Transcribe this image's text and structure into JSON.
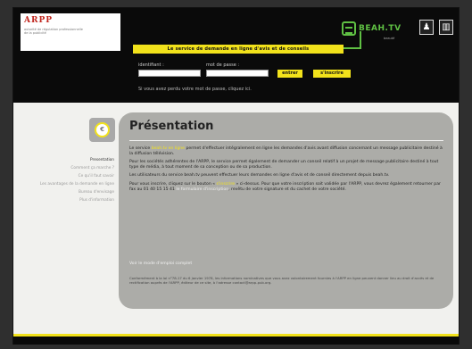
{
  "header": {
    "logo_title": "ARPP",
    "logo_subtitle": "autorité de régulation professionnelle de la publicité",
    "brand_name": "BEAH.TV",
    "brand_sub": "beauté",
    "tagline": "Le service de demande en ligne d'avis et de conseils",
    "login": {
      "identifier_label": "identifiant :",
      "password_label": "mot de passe :",
      "identifier_value": "",
      "password_value": "",
      "submit_label": "entrer",
      "register_label": "s'inscrire",
      "forgot_text": "Si vous avez perdu votre mot de passe, cliquez ici."
    }
  },
  "sidebar": {
    "items": [
      {
        "label": "Presentation"
      },
      {
        "label": "Comment ça marche ?"
      },
      {
        "label": "Ce qu'il faut savoir"
      },
      {
        "label": "Les avantages de la demande en ligne"
      },
      {
        "label": "Bureau d'envisage"
      },
      {
        "label": "Plus d'information"
      }
    ]
  },
  "main": {
    "title": "Présentation",
    "p1_a": "Le service ",
    "p1_hl": "beah.tv en ligne",
    "p1_b": " permet d'effectuer intégralement en ligne les demandes d'avis avant diffusion concernant un message publicitaire destiné à la diffusion télévision.",
    "p2": "Pour les sociétés adhérentes de l'ARPP, le service permet également de demander un conseil relatif à un projet de message publicitaire destiné à tout type de média, à tout moment de sa conception ou de sa production.",
    "p3": "Les utilisateurs du service beah.tv peuvent effectuer leurs demandes en ligne d'avis et de conseil directement depuis beah.tv.",
    "p4_a": "Pour vous inscrire, cliquez sur le bouton « ",
    "p4_hl": "s'inscrire",
    "p4_b": " » ci-dessus. Pour que votre inscription soit validée par l'ARPP, vous devrez également retourner par fax au 01 40 15 15 41 ",
    "p4_hl2": "le formulaire d'inscription",
    "p4_c": ", revêtu de votre signature et du cachet de votre société.",
    "link_label": "Voir le mode d'emploi complet",
    "footer_note": "Conformément à la loi n°78-17 du 6 janvier 1978, les informations nominatives que vous avez volontairement fournies à l'ARPP en ligne peuvent donner lieu au droit d'accès et de rectification auprès de l'ARPP, éditeur de ce site, à l'adresse contact@arpp-pub.org."
  },
  "colors": {
    "accent_yellow": "#f2e21b",
    "accent_green": "#5fc043",
    "panel_gray": "#acaca8"
  }
}
